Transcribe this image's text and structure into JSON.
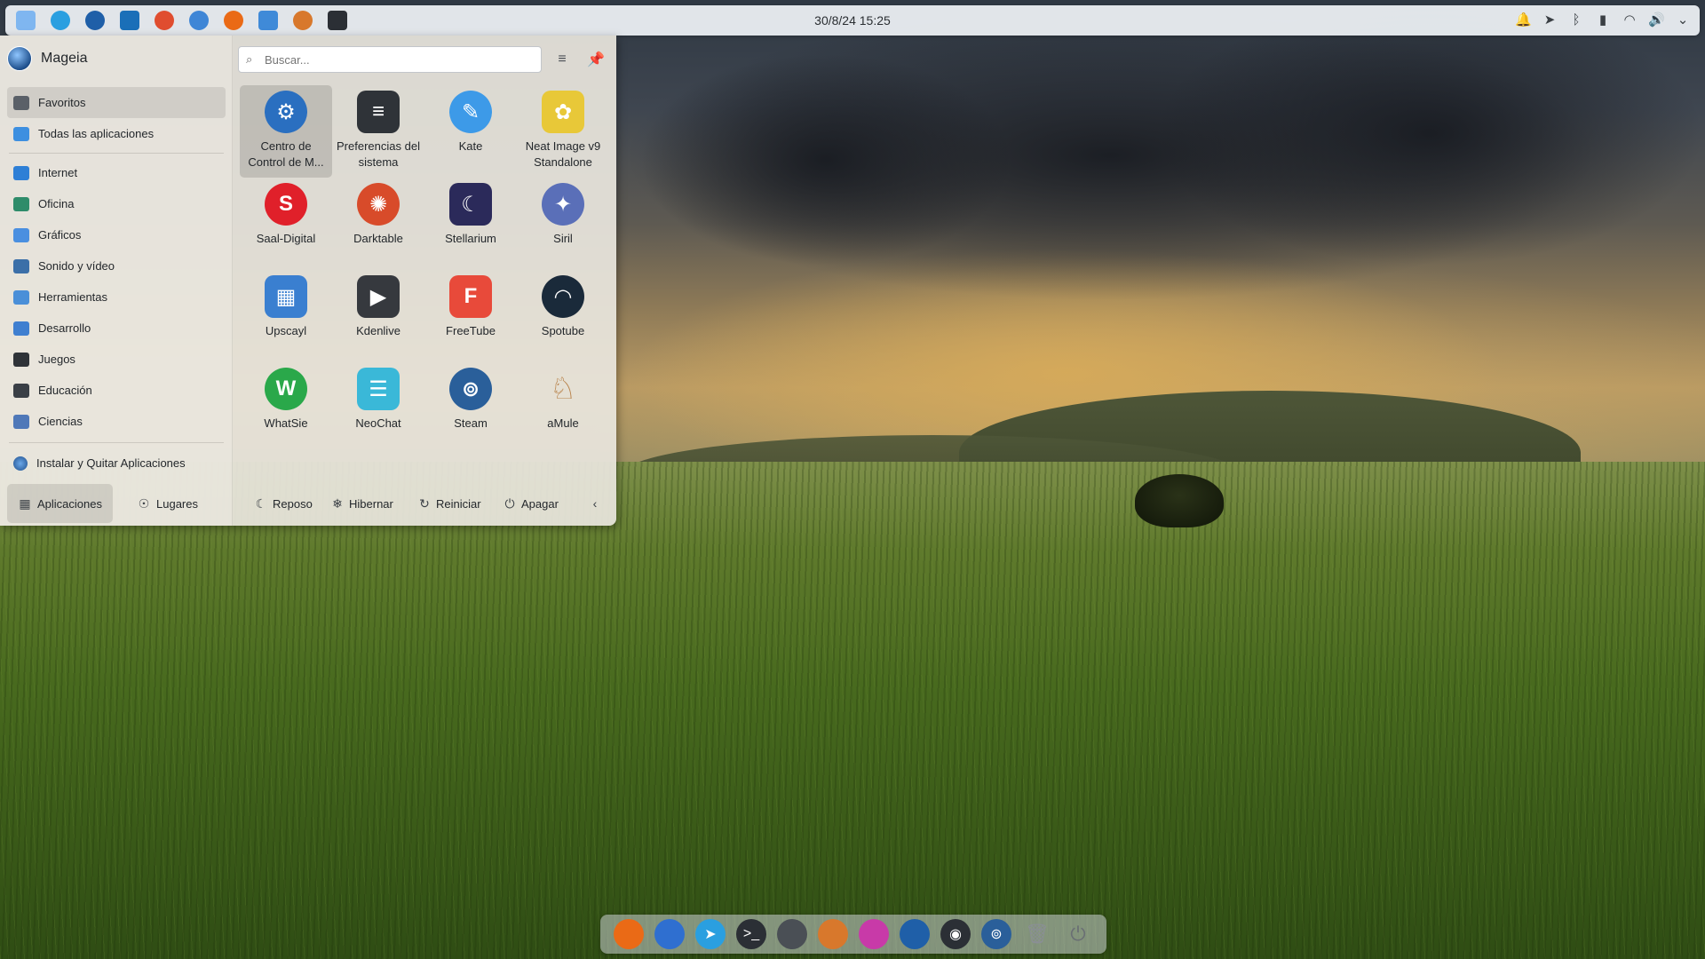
{
  "top_panel": {
    "clock": "30/8/24 15:25",
    "launchers": [
      {
        "name": "mageia-logo-icon",
        "color": "#7fb6f0"
      },
      {
        "name": "telegram-icon",
        "color": "#2a9fe0"
      },
      {
        "name": "thunderbird-icon",
        "color": "#1f5fa8"
      },
      {
        "name": "file-manager-icon",
        "color": "#1a6fb8"
      },
      {
        "name": "darktable-icon",
        "color": "#e04d2f"
      },
      {
        "name": "mail-icon",
        "color": "#3f86d6"
      },
      {
        "name": "firefox-icon",
        "color": "#ea6a16"
      },
      {
        "name": "document-icon",
        "color": "#3f8ad8"
      },
      {
        "name": "amule-icon",
        "color": "#d8782c"
      },
      {
        "name": "terminal-icon",
        "color": "#2b2f35"
      }
    ],
    "tray": [
      "notifications-icon",
      "telegram-tray-icon",
      "bluetooth-icon",
      "battery-icon",
      "wifi-icon",
      "volume-icon",
      "expand-tray-icon"
    ]
  },
  "launcher": {
    "user_name": "Mageia",
    "search_placeholder": "Buscar...",
    "categories": [
      {
        "label": "Favoritos",
        "icon": "bookmark-icon",
        "color": "#5a6068",
        "active": true
      },
      {
        "label": "Todas las aplicaciones",
        "icon": "grid-icon",
        "color": "#3d8fe0",
        "active": false
      },
      {
        "label": "Internet",
        "icon": "globe-icon",
        "color": "#2e7fd6",
        "active": false
      },
      {
        "label": "Oficina",
        "icon": "office-icon",
        "color": "#2e8c6a",
        "active": false
      },
      {
        "label": "Gráficos",
        "icon": "graphics-icon",
        "color": "#4a8fe0",
        "active": false
      },
      {
        "label": "Sonido y vídeo",
        "icon": "multimedia-icon",
        "color": "#3b6fa8",
        "active": false
      },
      {
        "label": "Herramientas",
        "icon": "tools-icon",
        "color": "#4a8fd8",
        "active": false
      },
      {
        "label": "Desarrollo",
        "icon": "development-icon",
        "color": "#3f7fd0",
        "active": false
      },
      {
        "label": "Juegos",
        "icon": "gamepad-icon",
        "color": "#2f3338",
        "active": false
      },
      {
        "label": "Educación",
        "icon": "education-icon",
        "color": "#3a3f46",
        "active": false
      },
      {
        "label": "Ciencias",
        "icon": "science-icon",
        "color": "#4f78b8",
        "active": false
      }
    ],
    "install_label": "Instalar y Quitar Aplicaciones",
    "apps": [
      {
        "label": "Centro de Control de M...",
        "icon": "control-center-icon",
        "color": "#2a6fc0",
        "glyph": "⚙",
        "active": true
      },
      {
        "label": "Preferencias del sistema",
        "icon": "system-settings-icon",
        "color": "#2f3338",
        "glyph": "≡",
        "active": false
      },
      {
        "label": "Kate",
        "icon": "kate-icon",
        "color": "#3d9ae8",
        "glyph": "✎",
        "active": false
      },
      {
        "label": "Neat Image v9 Standalone",
        "icon": "neat-image-icon",
        "color": "#e8c838",
        "glyph": "✿",
        "active": false
      },
      {
        "label": "Saal-Digital",
        "icon": "saal-digital-icon",
        "color": "#e0202a",
        "glyph": "S",
        "active": false
      },
      {
        "label": "Darktable",
        "icon": "darktable-icon",
        "color": "#d84b2a",
        "glyph": "✺",
        "active": false
      },
      {
        "label": "Stellarium",
        "icon": "stellarium-icon",
        "color": "#2b2a5a",
        "glyph": "☾",
        "active": false
      },
      {
        "label": "Siril",
        "icon": "siril-icon",
        "color": "#5a6fb8",
        "glyph": "✦",
        "active": false
      },
      {
        "label": "Upscayl",
        "icon": "upscayl-icon",
        "color": "#3a7fd0",
        "glyph": "▦",
        "active": false
      },
      {
        "label": "Kdenlive",
        "icon": "kdenlive-icon",
        "color": "#36393e",
        "glyph": "▶",
        "active": false
      },
      {
        "label": "FreeTube",
        "icon": "freetube-icon",
        "color": "#e84a3a",
        "glyph": "F",
        "active": false
      },
      {
        "label": "Spotube",
        "icon": "spotube-icon",
        "color": "#1a2a3a",
        "glyph": "◠",
        "active": false
      },
      {
        "label": "WhatSie",
        "icon": "whatsie-icon",
        "color": "#2aa84a",
        "glyph": "W",
        "active": false
      },
      {
        "label": "NeoChat",
        "icon": "neochat-icon",
        "color": "#3ab8d8",
        "glyph": "☰",
        "active": false
      },
      {
        "label": "Steam",
        "icon": "steam-icon",
        "color": "#2a5f9a",
        "glyph": "⊚",
        "active": false
      },
      {
        "label": "aMule",
        "icon": "amule-icon",
        "color": "#b8824a",
        "glyph": "♘",
        "active": false
      }
    ],
    "footer": {
      "tab_apps": "Aplicaciones",
      "tab_places": "Lugares",
      "sleep": "Reposo",
      "hibernate": "Hibernar",
      "restart": "Reiniciar",
      "shutdown": "Apagar"
    }
  },
  "dock": {
    "items": [
      {
        "name": "firefox-icon",
        "color": "#ea6a16"
      },
      {
        "name": "thunderbird-icon",
        "color": "#2f6fd0"
      },
      {
        "name": "telegram-icon",
        "color": "#2a9fe0"
      },
      {
        "name": "terminal-icon",
        "color": "#2b2f35"
      },
      {
        "name": "aperture-icon",
        "color": "#4a4f55"
      },
      {
        "name": "amule-icon",
        "color": "#d8782c"
      },
      {
        "name": "kolourpaint-icon",
        "color": "#c83aa8"
      },
      {
        "name": "mail-icon",
        "color": "#1f5fa8"
      },
      {
        "name": "record-icon",
        "color": "#2b2f35"
      },
      {
        "name": "steam-icon",
        "color": "#2a5f9a"
      },
      {
        "name": "trash-icon",
        "color": "#8a8f94"
      },
      {
        "name": "power-icon",
        "color": "#6a6f74"
      }
    ]
  }
}
